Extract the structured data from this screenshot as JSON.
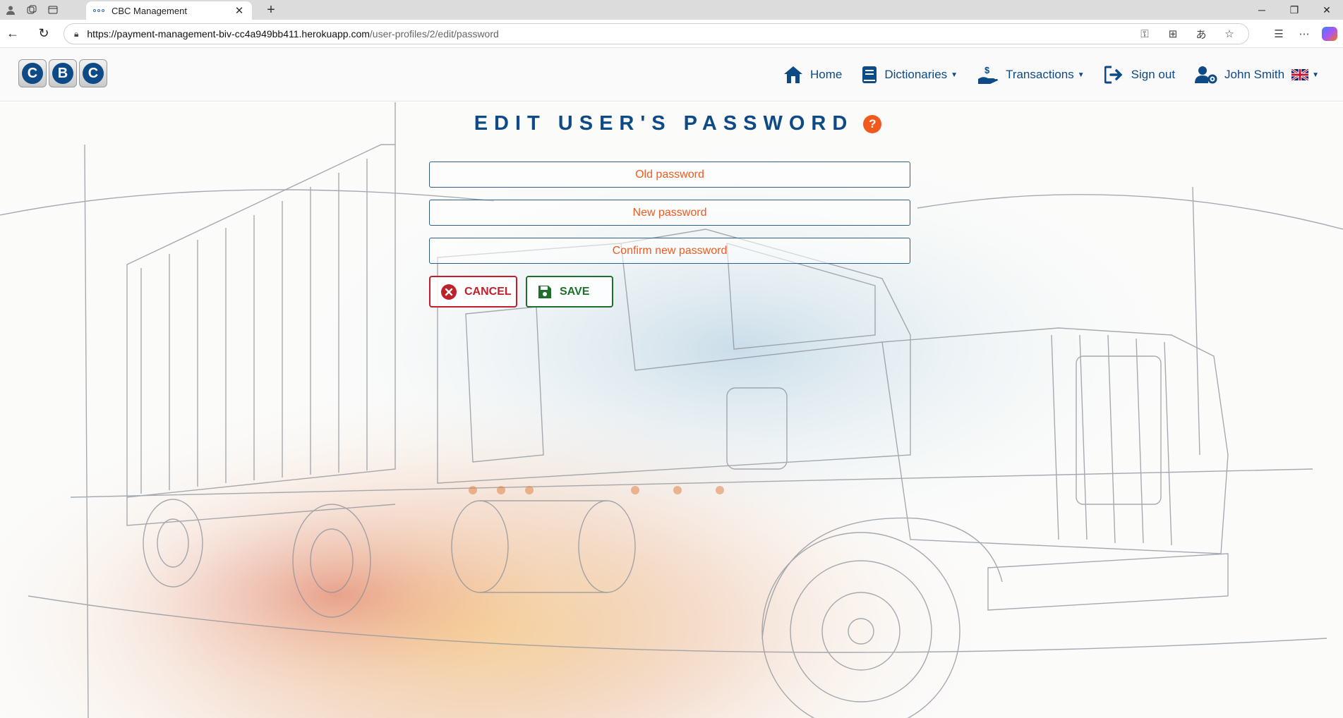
{
  "browser": {
    "tab_title": "CBC Management",
    "url_host": "https://payment-management-biv-cc4a949bb411.herokuapp.com",
    "url_path": "/user-profiles/2/edit/password"
  },
  "nav": {
    "logo_letters": [
      "C",
      "B",
      "C"
    ],
    "home": "Home",
    "dictionaries": "Dictionaries",
    "transactions": "Transactions",
    "sign_out": "Sign out",
    "user_name": "John Smith"
  },
  "page": {
    "title": "EDIT USER'S PASSWORD",
    "help_symbol": "?"
  },
  "form": {
    "old_password_placeholder": "Old password",
    "new_password_placeholder": "New password",
    "confirm_password_placeholder": "Confirm new password",
    "cancel_label": "CANCEL",
    "save_label": "SAVE"
  },
  "colors": {
    "brand_blue": "#0d4a86",
    "accent_orange": "#f05a1e",
    "cancel_red": "#c0202a",
    "save_green": "#1f6e2c"
  }
}
